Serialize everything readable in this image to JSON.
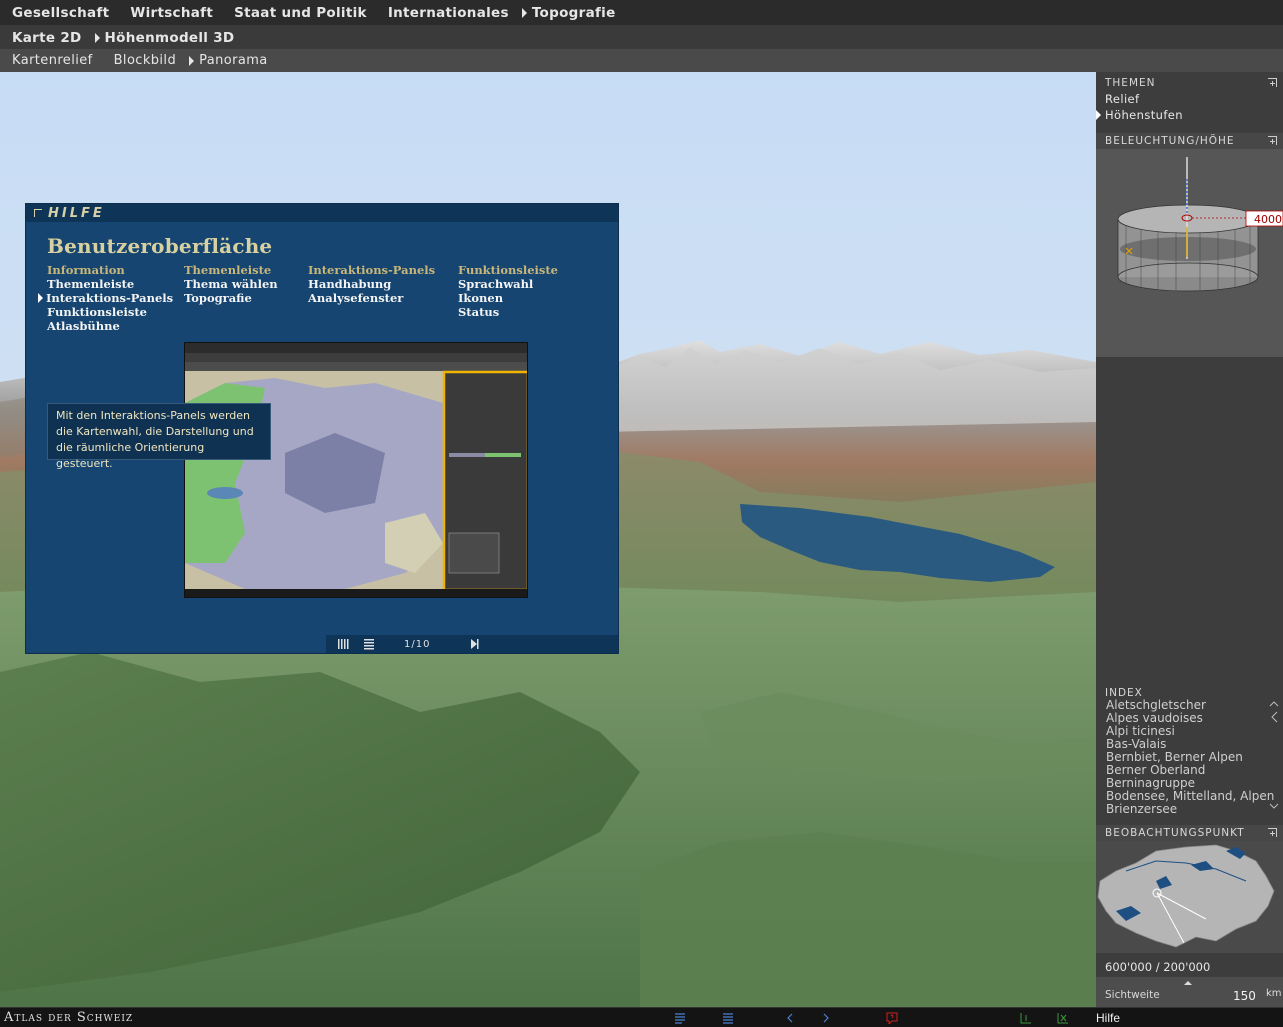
{
  "menu": {
    "level1": [
      "Gesellschaft",
      "Wirtschaft",
      "Staat und Politik",
      "Internationales",
      "Topografie"
    ],
    "level2": [
      "Karte 2D",
      "Höhenmodell 3D"
    ],
    "level3": [
      "Kartenrelief",
      "Blockbild",
      "Panorama"
    ]
  },
  "panel": {
    "themen_title": "THEMEN",
    "themen": [
      "Relief",
      "Höhenstufen"
    ],
    "beleuchtung_title": "BELEUCHTUNG/HÖHE",
    "height_value": "4000",
    "index_title": "INDEX",
    "index_items": [
      "Aletschgletscher",
      "Alpes vaudoises",
      "Alpi ticinesi",
      "Bas-Valais",
      "Bernbiet, Berner Alpen",
      "Berner Oberland",
      "Berninagruppe",
      "Bodensee, Mittelland, Alpen",
      "Brienzersee"
    ],
    "beobachtung_title": "BEOBACHTUNGSPUNKT",
    "coordinates": "600'000 / 200'000",
    "sichtweite_label": "Sichtweite",
    "sichtweite_value": "150",
    "sichtweite_unit": "km"
  },
  "help": {
    "title": "HILFE",
    "heading": "Benutzeroberfläche",
    "columns": [
      {
        "head": "Information",
        "items": [
          "Themenleiste",
          "Interaktions-Panels",
          "Funktionsleiste",
          "Atlasbühne"
        ]
      },
      {
        "head": "Themenleiste",
        "items": [
          "Thema wählen",
          "Topografie"
        ]
      },
      {
        "head": "Interaktions-Panels",
        "items": [
          "Handhabung",
          "Analysefenster"
        ]
      },
      {
        "head": "Funktionsleiste",
        "items": [
          "Sprachwahl",
          "Ikonen",
          "Status"
        ]
      }
    ],
    "tooltip": [
      "Mit den Interaktions-Panels werden",
      "die Kartenwahl, die Darstellung und",
      "die räumliche Orientierung gesteuert."
    ],
    "page": "1/10"
  },
  "footer": {
    "brand": "Atlas der Schweiz",
    "hilfe": "Hilfe"
  },
  "colors": {
    "help_bg": "#154570",
    "help_accent": "#d7d0a0",
    "highlight": "#f0b400",
    "lake": "#2a5a80"
  }
}
